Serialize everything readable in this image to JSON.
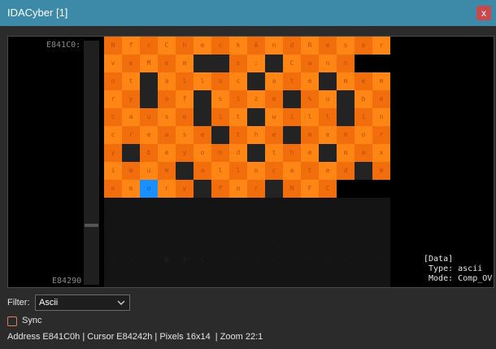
{
  "window": {
    "title": "IDACyber [1]",
    "close_label": "x"
  },
  "view": {
    "start_address": "E841C0:",
    "end_address": "E84290",
    "rows": [
      "NfcCheckAndReser",
      "veMem__s:_Cann",
      "ot_alloc_ate_memo",
      "ry_of_size_%u_be",
      "cause_it_will_in",
      "crease_the_memor",
      "y_beyond_the_max",
      "imum_allocated_m",
      "emory_for_NFC"
    ],
    "dim_rows": [
      "................",
      "................",
      "................",
      "...NFC..........",
      "................"
    ],
    "cursor_index": 130
  },
  "info_panel": {
    "text": "[Data]\n Type: ascii\n Mode: Comp_OV"
  },
  "filter": {
    "label": "Filter:",
    "value": "Ascii"
  },
  "sync": {
    "label": "Sync",
    "checked": false
  },
  "status": {
    "text": "Address E841C0h | Cursor E84242h | Pixels 16x14  | Zoom 22:1"
  },
  "colors": {
    "accent": "#3d8aa8",
    "cell_fill": "#f26d0c",
    "cell_alt": "#ff8515",
    "cell_dark": "#232323",
    "cursor": "#1a8fff"
  }
}
